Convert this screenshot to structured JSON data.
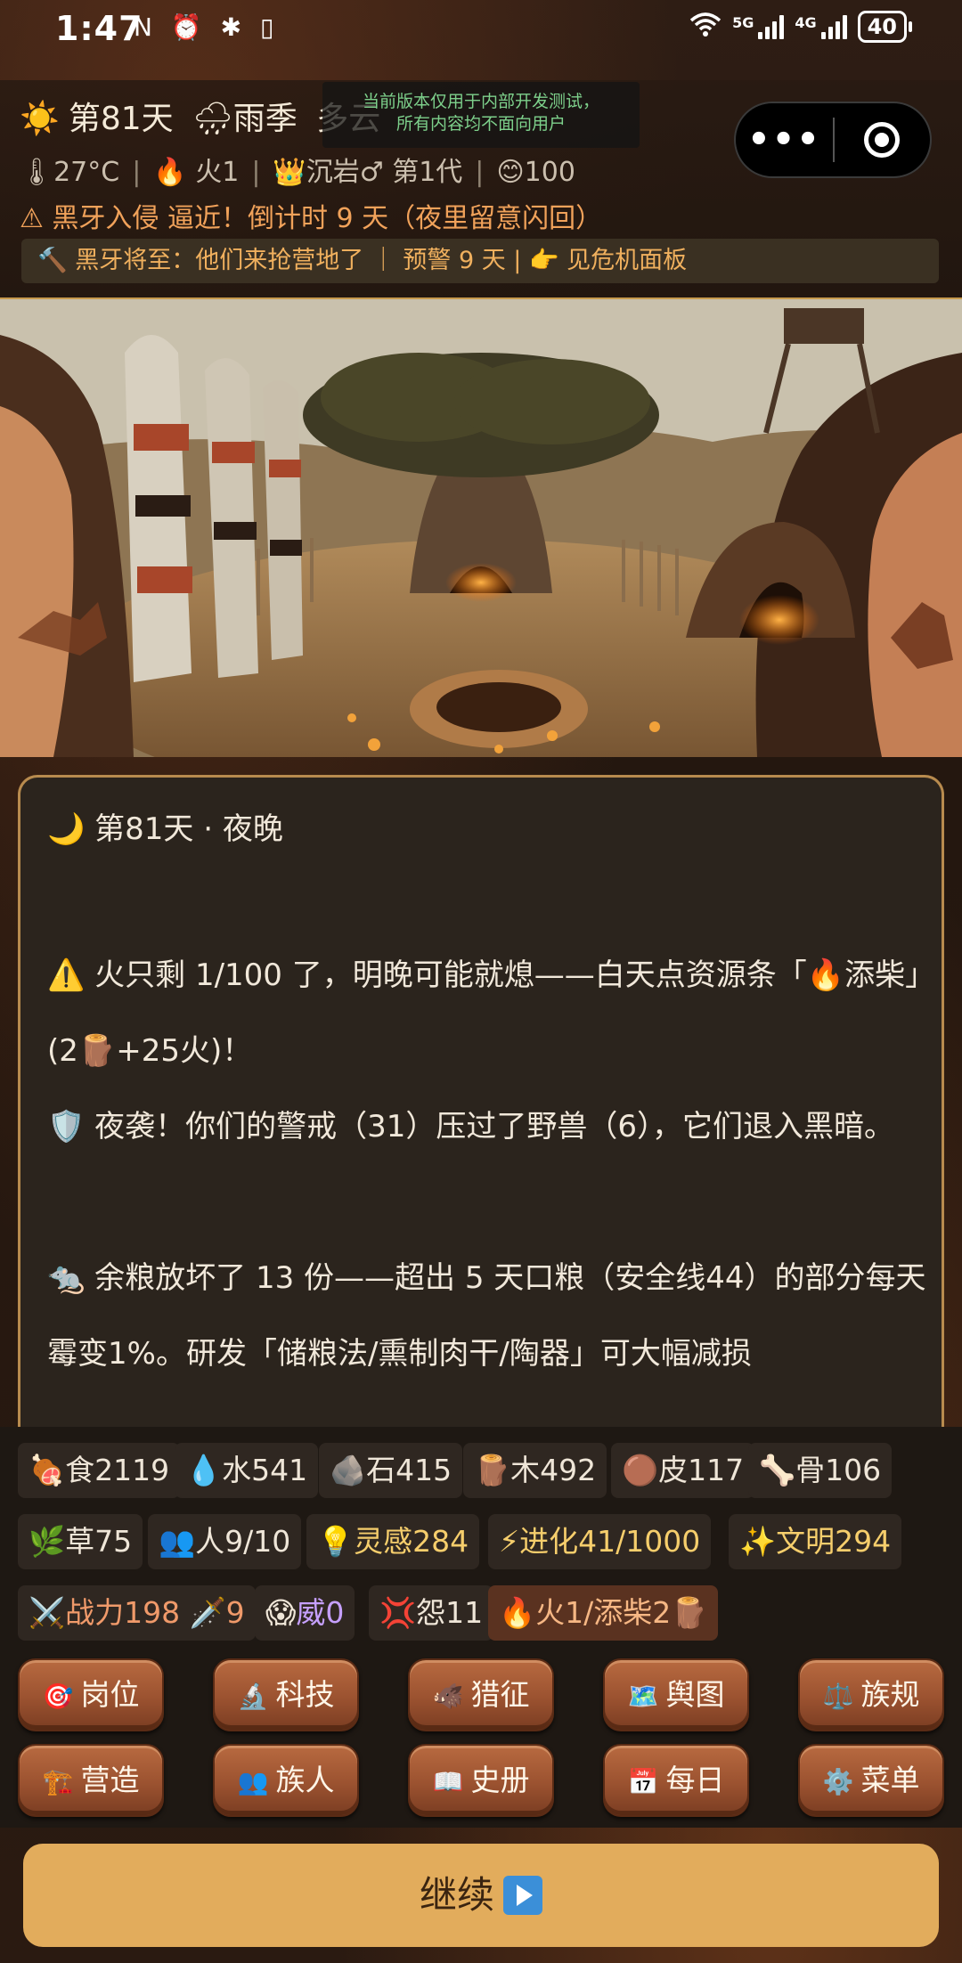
{
  "status_bar": {
    "time": "1:47",
    "left_icons": "N ⏰ ✱ ▯",
    "signal1_label": "5G",
    "signal2_label": "4G",
    "battery": "40"
  },
  "header": {
    "weather_icon": "☀️",
    "day": "第81天",
    "season_icon": "🌧",
    "season": "雨季",
    "cloud": "多云",
    "dev_notice_line1": "当前版本仅用于内部开发测试，",
    "dev_notice_line2": "所有内容均不面向用户",
    "temp": "🌡27°C",
    "fire": "🔥 火1",
    "leader": "👑沉岩♂ 第1代",
    "mood": "😊100",
    "warning": "⚠ 黑牙入侵 逼近！倒计时 9 天（夜里留意闪回）",
    "alert": "🔨 黑牙将至：他们来抢营地了 ｜ 预警 9 天 | 👉 见危机面板"
  },
  "story": {
    "title": "🌙 第81天 · 夜晚",
    "paragraphs": [
      "⚠️ 火只剩 1/100 了，明晚可能就熄——白天点资源条「🔥添柴」(2🪵+25火)！",
      "🛡️ 夜袭！你们的警戒（31）压过了野兽（6），它们退入黑暗。",
      "🐀 余粮放坏了 13 份——超出 5 天口粮（安全线44）的部分每天霉变1%。研发「储粮法/熏制肉干/陶器」可大幅减损"
    ]
  },
  "resources": {
    "food": "🍖食2119",
    "water": "💧水541",
    "stone": "🪨石415",
    "wood": "🪵木492",
    "hide": "🟤皮117",
    "bone": "🦴骨106",
    "grass": "🌿草75",
    "people": "👥人9/10",
    "inspiration": "💡灵感284",
    "evolution": "⚡进化41/1000",
    "civilization": "✨文明294",
    "combat": "⚔️战力198 🗡️9",
    "awe_icon": "😱",
    "awe": "威0",
    "grudge_icon": "💢",
    "grudge": "怨11",
    "fire_action": "🔥火1/添柴2🪵"
  },
  "buttons": {
    "row1": [
      {
        "icon": "🎯",
        "label": "岗位"
      },
      {
        "icon": "🔬",
        "label": "科技"
      },
      {
        "icon": "🐗",
        "label": "猎征"
      },
      {
        "icon": "🗺️",
        "label": "舆图"
      },
      {
        "icon": "⚖️",
        "label": "族规"
      }
    ],
    "row2": [
      {
        "icon": "🏗️",
        "label": "营造"
      },
      {
        "icon": "👥",
        "label": "族人"
      },
      {
        "icon": "📖",
        "label": "史册"
      },
      {
        "icon": "📅",
        "label": "每日"
      },
      {
        "icon": "⚙️",
        "label": "菜单"
      }
    ],
    "continue": "继续"
  }
}
